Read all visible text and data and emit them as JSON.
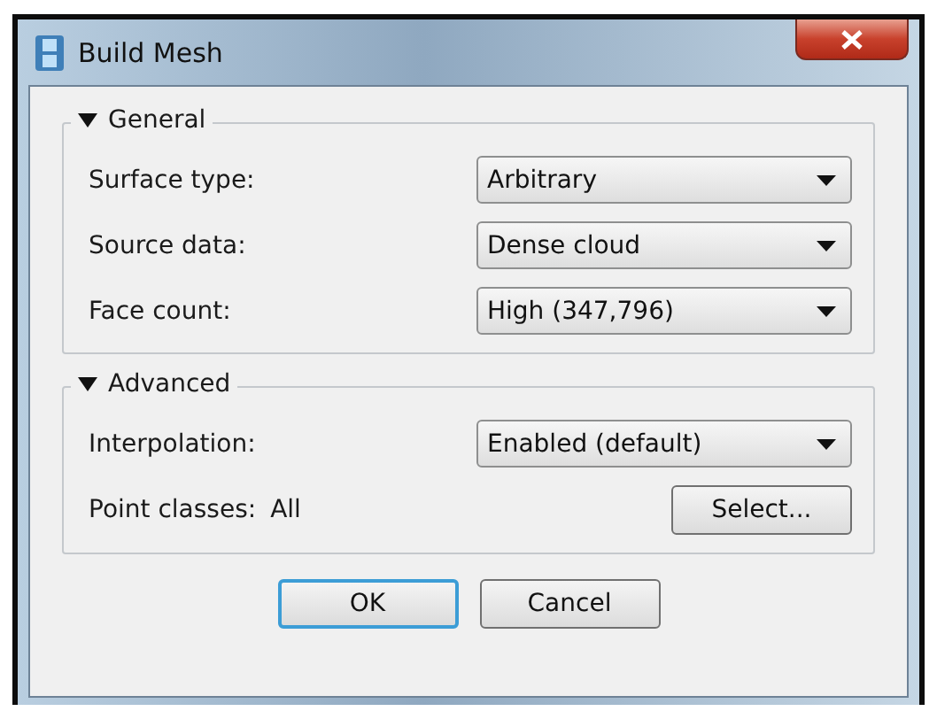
{
  "window": {
    "title": "Build Mesh"
  },
  "groups": [
    {
      "title": "General",
      "expanded": true,
      "rows": [
        {
          "kind": "combo",
          "label": "Surface type:",
          "value": "Arbitrary"
        },
        {
          "kind": "combo",
          "label": "Source data:",
          "value": "Dense cloud"
        },
        {
          "kind": "combo",
          "label": "Face count:",
          "value": "High (347,796)"
        }
      ]
    },
    {
      "title": "Advanced",
      "expanded": true,
      "rows": [
        {
          "kind": "combo",
          "label": "Interpolation:",
          "value": "Enabled (default)"
        },
        {
          "kind": "select",
          "label": "Point classes:",
          "value": "All",
          "button": "Select..."
        }
      ]
    }
  ],
  "buttons": [
    {
      "label": "OK",
      "default": true
    },
    {
      "label": "Cancel",
      "default": false
    }
  ]
}
